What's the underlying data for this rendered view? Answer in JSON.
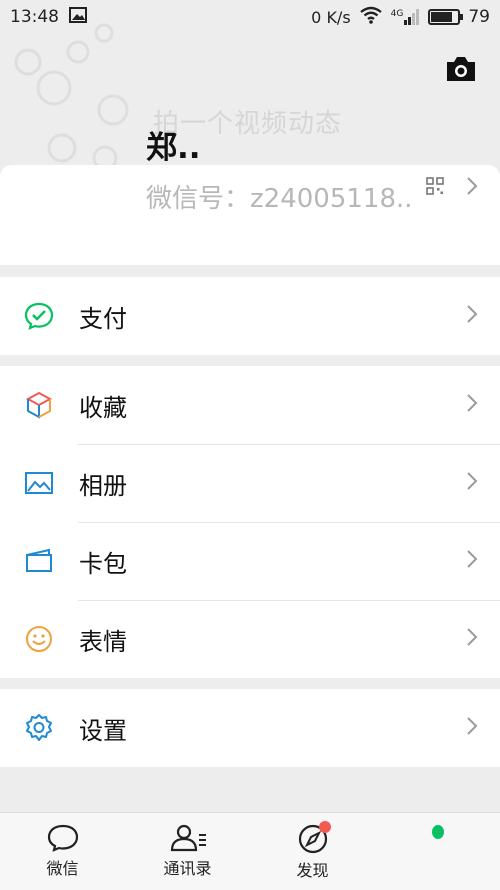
{
  "status_bar": {
    "time": "13:48",
    "network_speed": "0 K/s",
    "signal_label": "4G",
    "battery": "79",
    "battery_level": 0.79
  },
  "profile": {
    "video_hint": "拍一个视频动态",
    "nickname": "郑..",
    "wechat_id": "微信号：z24005118.."
  },
  "menu": {
    "pay": "支付",
    "favorites": "收藏",
    "album": "相册",
    "cards": "卡包",
    "stickers": "表情",
    "settings": "设置"
  },
  "tabbar": {
    "chats": "微信",
    "contacts": "通讯录",
    "discover": "发现"
  },
  "colors": {
    "accent_green": "#07c160",
    "badge_red": "#f25a52",
    "icon_blue": "#1f8ad2",
    "icon_orange": "#f0a13b"
  }
}
